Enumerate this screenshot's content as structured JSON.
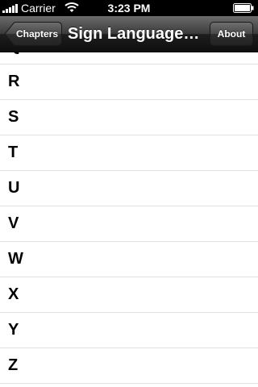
{
  "status_bar": {
    "carrier": "Carrier",
    "time": "3:23 PM",
    "icons": [
      "signal-icon",
      "wifi-icon",
      "battery-icon"
    ]
  },
  "nav_bar": {
    "back_label": "Chapters",
    "title": "Sign Language…",
    "about_label": "About"
  },
  "list": {
    "items": [
      {
        "label": "Q"
      },
      {
        "label": "R"
      },
      {
        "label": "S"
      },
      {
        "label": "T"
      },
      {
        "label": "U"
      },
      {
        "label": "V"
      },
      {
        "label": "W"
      },
      {
        "label": "X"
      },
      {
        "label": "Y"
      },
      {
        "label": "Z"
      }
    ]
  },
  "colors": {
    "status_bar_bg": "#000000",
    "nav_bar_bg": "#1e1e1e",
    "separator": "#e0e0e0",
    "text": "#000000"
  }
}
